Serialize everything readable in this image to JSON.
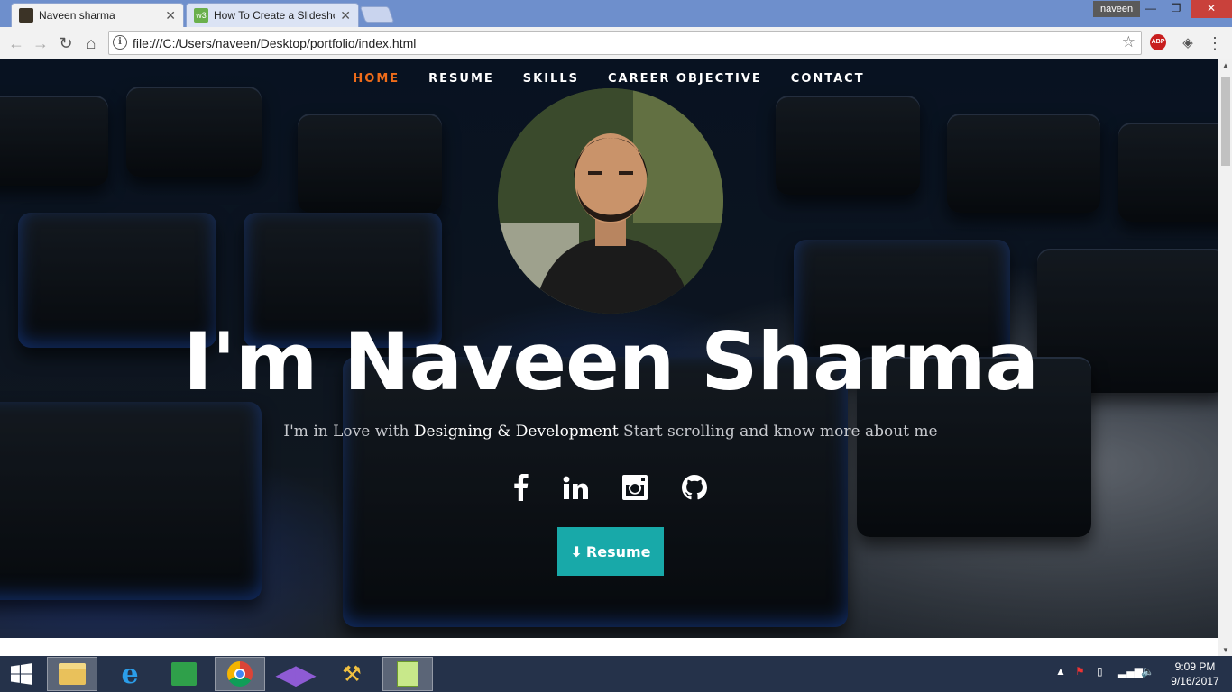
{
  "browser": {
    "tabs": [
      {
        "title": "Naveen sharma",
        "active": true
      },
      {
        "title": "How To Create a Slideshow",
        "active": false
      }
    ],
    "user": "naveen",
    "url": "file:///C:/Users/naveen/Desktop/portfolio/index.html",
    "extension_abp": "ABP"
  },
  "nav": {
    "items": [
      {
        "label": "HOME",
        "active": true
      },
      {
        "label": "RESUME"
      },
      {
        "label": "SKILLS"
      },
      {
        "label": "CAREER OBJECTIVE"
      },
      {
        "label": "CONTACT"
      }
    ]
  },
  "hero": {
    "title": "I'm Naveen Sharma",
    "tagline_prefix": "I'm in Love with ",
    "tagline_strong": "Designing & Development",
    "tagline_suffix": " Start scrolling and know more about me",
    "button_label": "Resume",
    "socials": [
      "facebook-icon",
      "linkedin-icon",
      "instagram-icon",
      "github-icon"
    ]
  },
  "taskbar": {
    "time": "9:09 PM",
    "date": "9/16/2017"
  },
  "colors": {
    "accent_nav": "#ef6c1a",
    "button": "#18a9a9"
  }
}
